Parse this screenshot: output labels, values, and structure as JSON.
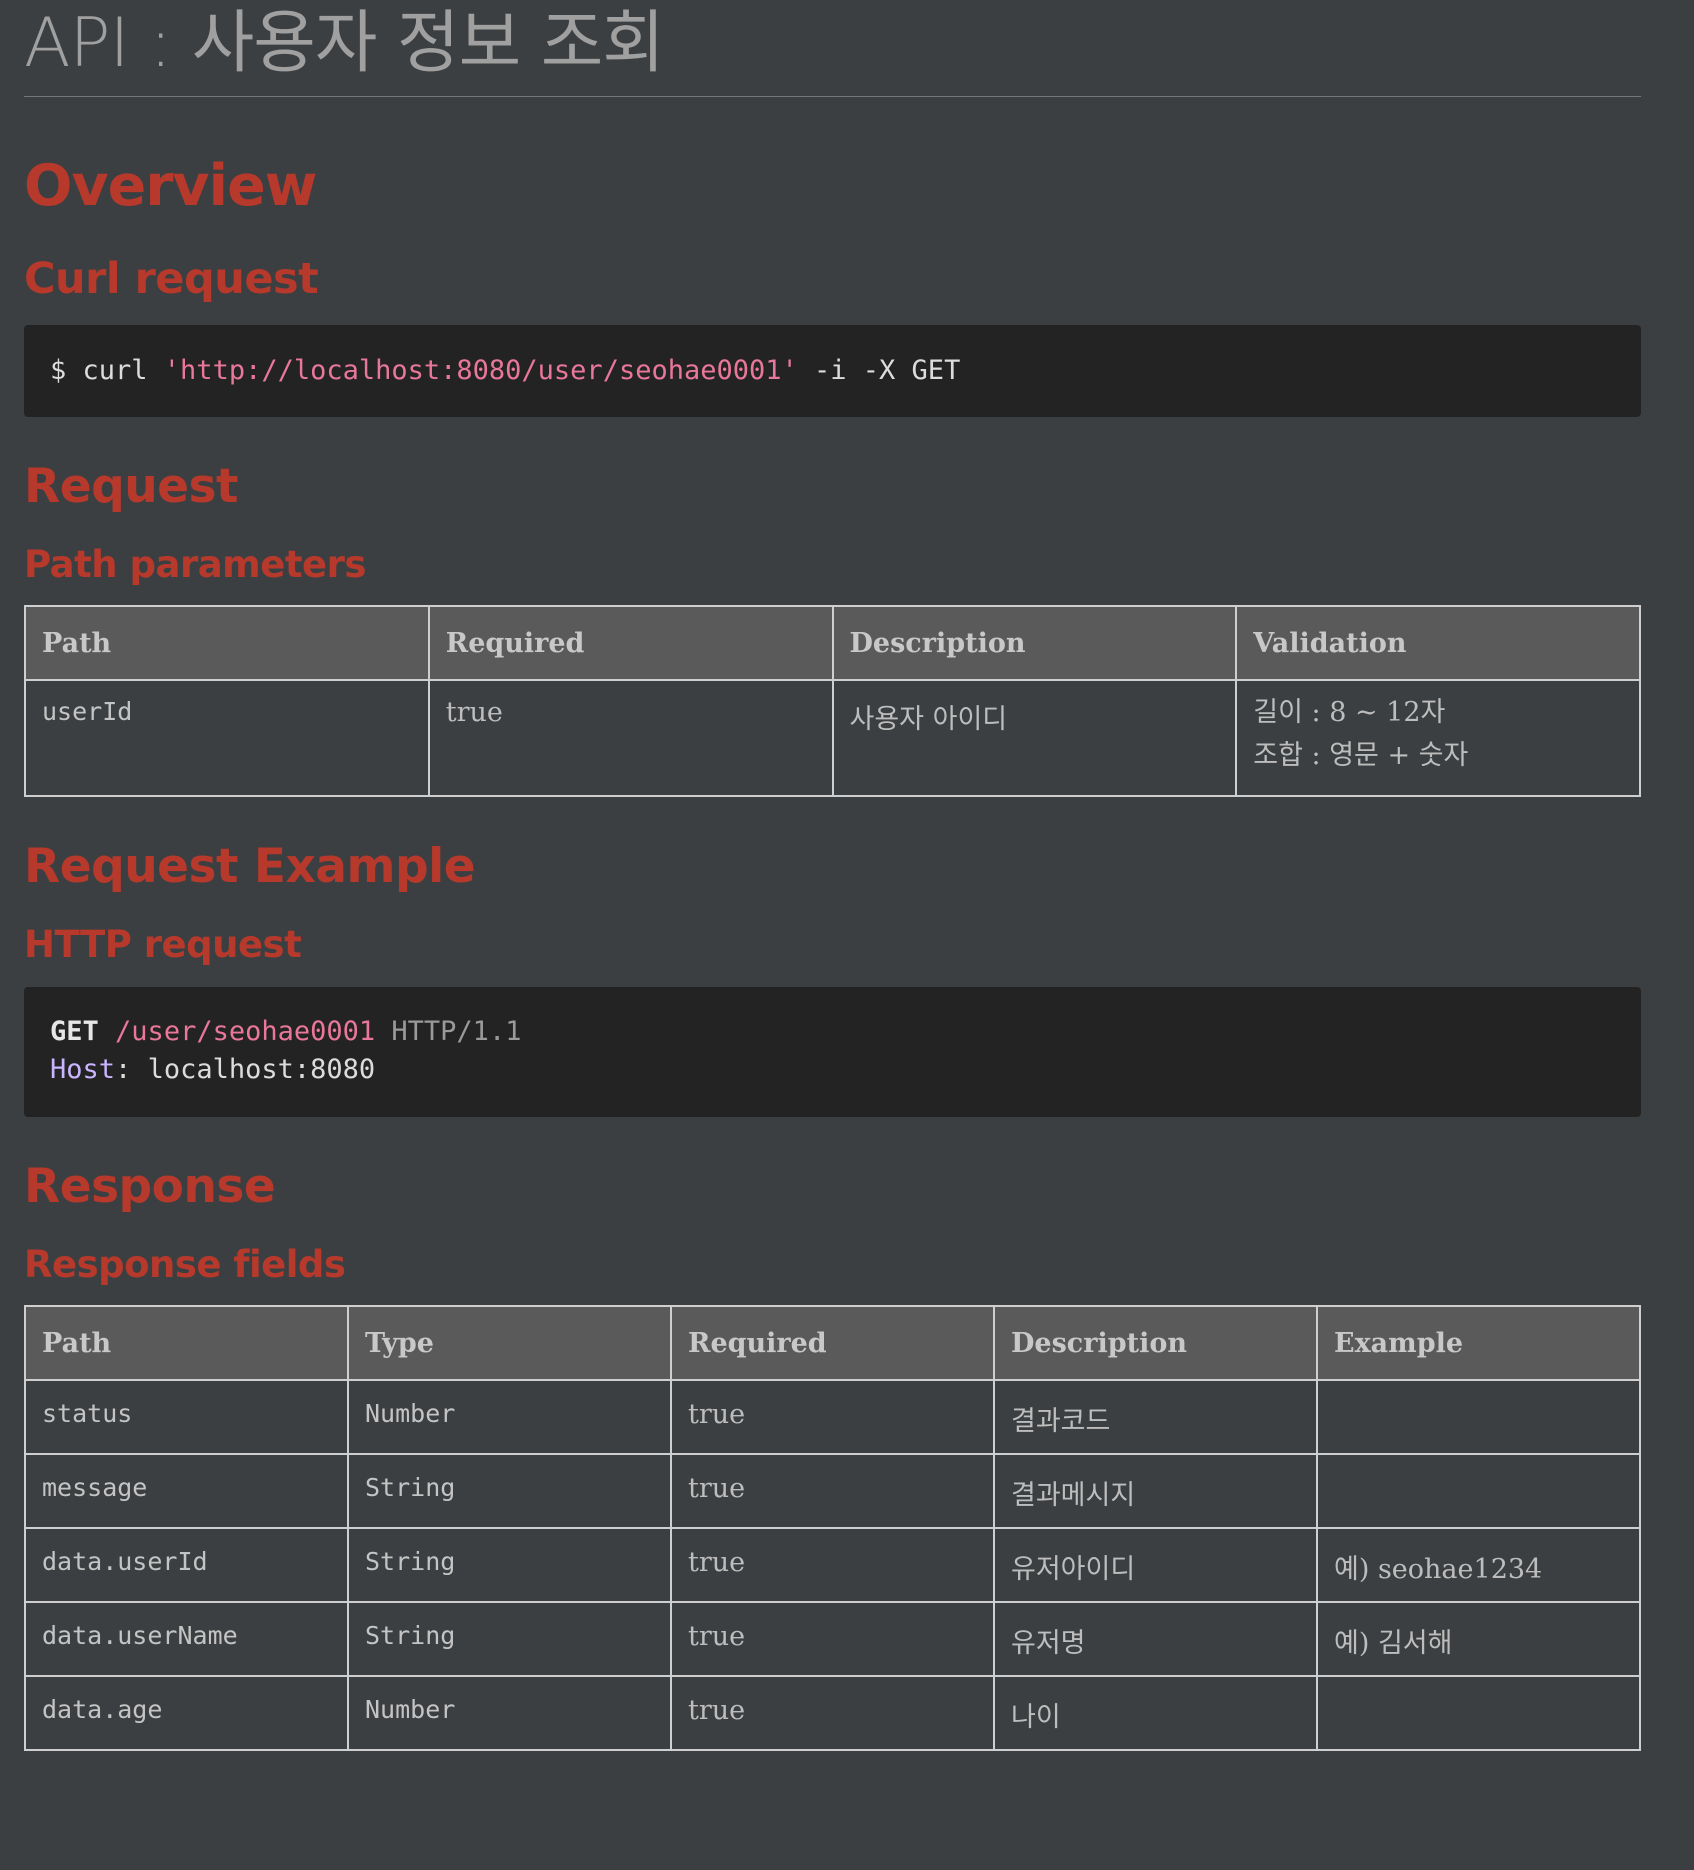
{
  "title": "API : 사용자 정보 조회",
  "sections": {
    "overview": "Overview",
    "curl_request": "Curl request",
    "request": "Request",
    "path_parameters": "Path parameters",
    "request_example": "Request Example",
    "http_request": "HTTP request",
    "response": "Response",
    "response_fields": "Response fields"
  },
  "curl": {
    "prompt": "$ curl ",
    "url": "'http://localhost:8080/user/seohae0001'",
    "args": " -i -X GET"
  },
  "http": {
    "method": "GET",
    "path": "/user/seohae0001",
    "version": "HTTP/1.1",
    "host_key": "Host",
    "host_sep": ":",
    "host_value": "localhost:8080"
  },
  "path_params": {
    "headers": [
      "Path",
      "Required",
      "Description",
      "Validation"
    ],
    "rows": [
      {
        "path": "userId",
        "required": "true",
        "description": "사용자 아이디",
        "validation": [
          "길이 : 8 ~ 12자",
          "조합 : 영문 + 숫자"
        ]
      }
    ]
  },
  "response_fields": {
    "headers": [
      "Path",
      "Type",
      "Required",
      "Description",
      "Example"
    ],
    "rows": [
      {
        "path": "status",
        "type": "Number",
        "required": "true",
        "description": "결과코드",
        "example": ""
      },
      {
        "path": "message",
        "type": "String",
        "required": "true",
        "description": "결과메시지",
        "example": ""
      },
      {
        "path": "data.userId",
        "type": "String",
        "required": "true",
        "description": "유저아이디",
        "example": "예) seohae1234"
      },
      {
        "path": "data.userName",
        "type": "String",
        "required": "true",
        "description": "유저명",
        "example": "예) 김서해"
      },
      {
        "path": "data.age",
        "type": "Number",
        "required": "true",
        "description": "나이",
        "example": ""
      }
    ]
  },
  "colors": {
    "background": "#3c3f41",
    "heading": "#b7392c",
    "code_bg": "#232323",
    "string": "#e8779a"
  }
}
